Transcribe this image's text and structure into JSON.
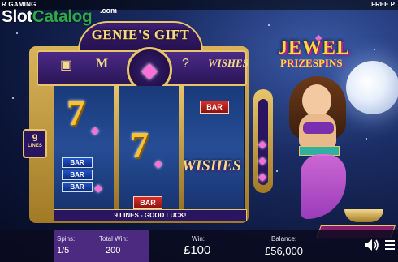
{
  "header": {
    "left_text": "R GAMING",
    "right_text": "FREE P"
  },
  "watermark": {
    "part1": "Slot",
    "part2": "Catalog",
    "domain": ".com"
  },
  "machine": {
    "title": "GENIE'S GIFT",
    "top_panel": {
      "left_symbol": "chest-icon",
      "center_symbol": "gem-icon",
      "right_text": "WISHES"
    },
    "lines_count": "9",
    "lines_label": "LINES",
    "message": "9 LINES - GOOD LUCK!"
  },
  "reels": [
    {
      "symbols": [
        "seven",
        "bar-stack"
      ],
      "bars": [
        "BAR",
        "BAR",
        "BAR"
      ]
    },
    {
      "symbols": [
        "seven",
        "bar"
      ],
      "bar_label": "BAR"
    },
    {
      "symbols": [
        "bar",
        "wishes"
      ],
      "bar_label": "BAR",
      "wishes_text": "WISHES"
    }
  ],
  "logo": {
    "line1": "JEWEL",
    "line2": "PRIZESPINS"
  },
  "stats": {
    "spins_label": "Spins:",
    "spins_value": "1/5",
    "total_win_label": "Total Win:",
    "total_win_value": "200",
    "win_label": "Win:",
    "win_value": "£100",
    "balance_label": "Balance:",
    "balance_value": "£56,000"
  },
  "colors": {
    "gold": "#e8c56a",
    "purple": "#2a1560",
    "gem_pink": "#ff6fd8",
    "seven_yellow": "#f7c236"
  }
}
